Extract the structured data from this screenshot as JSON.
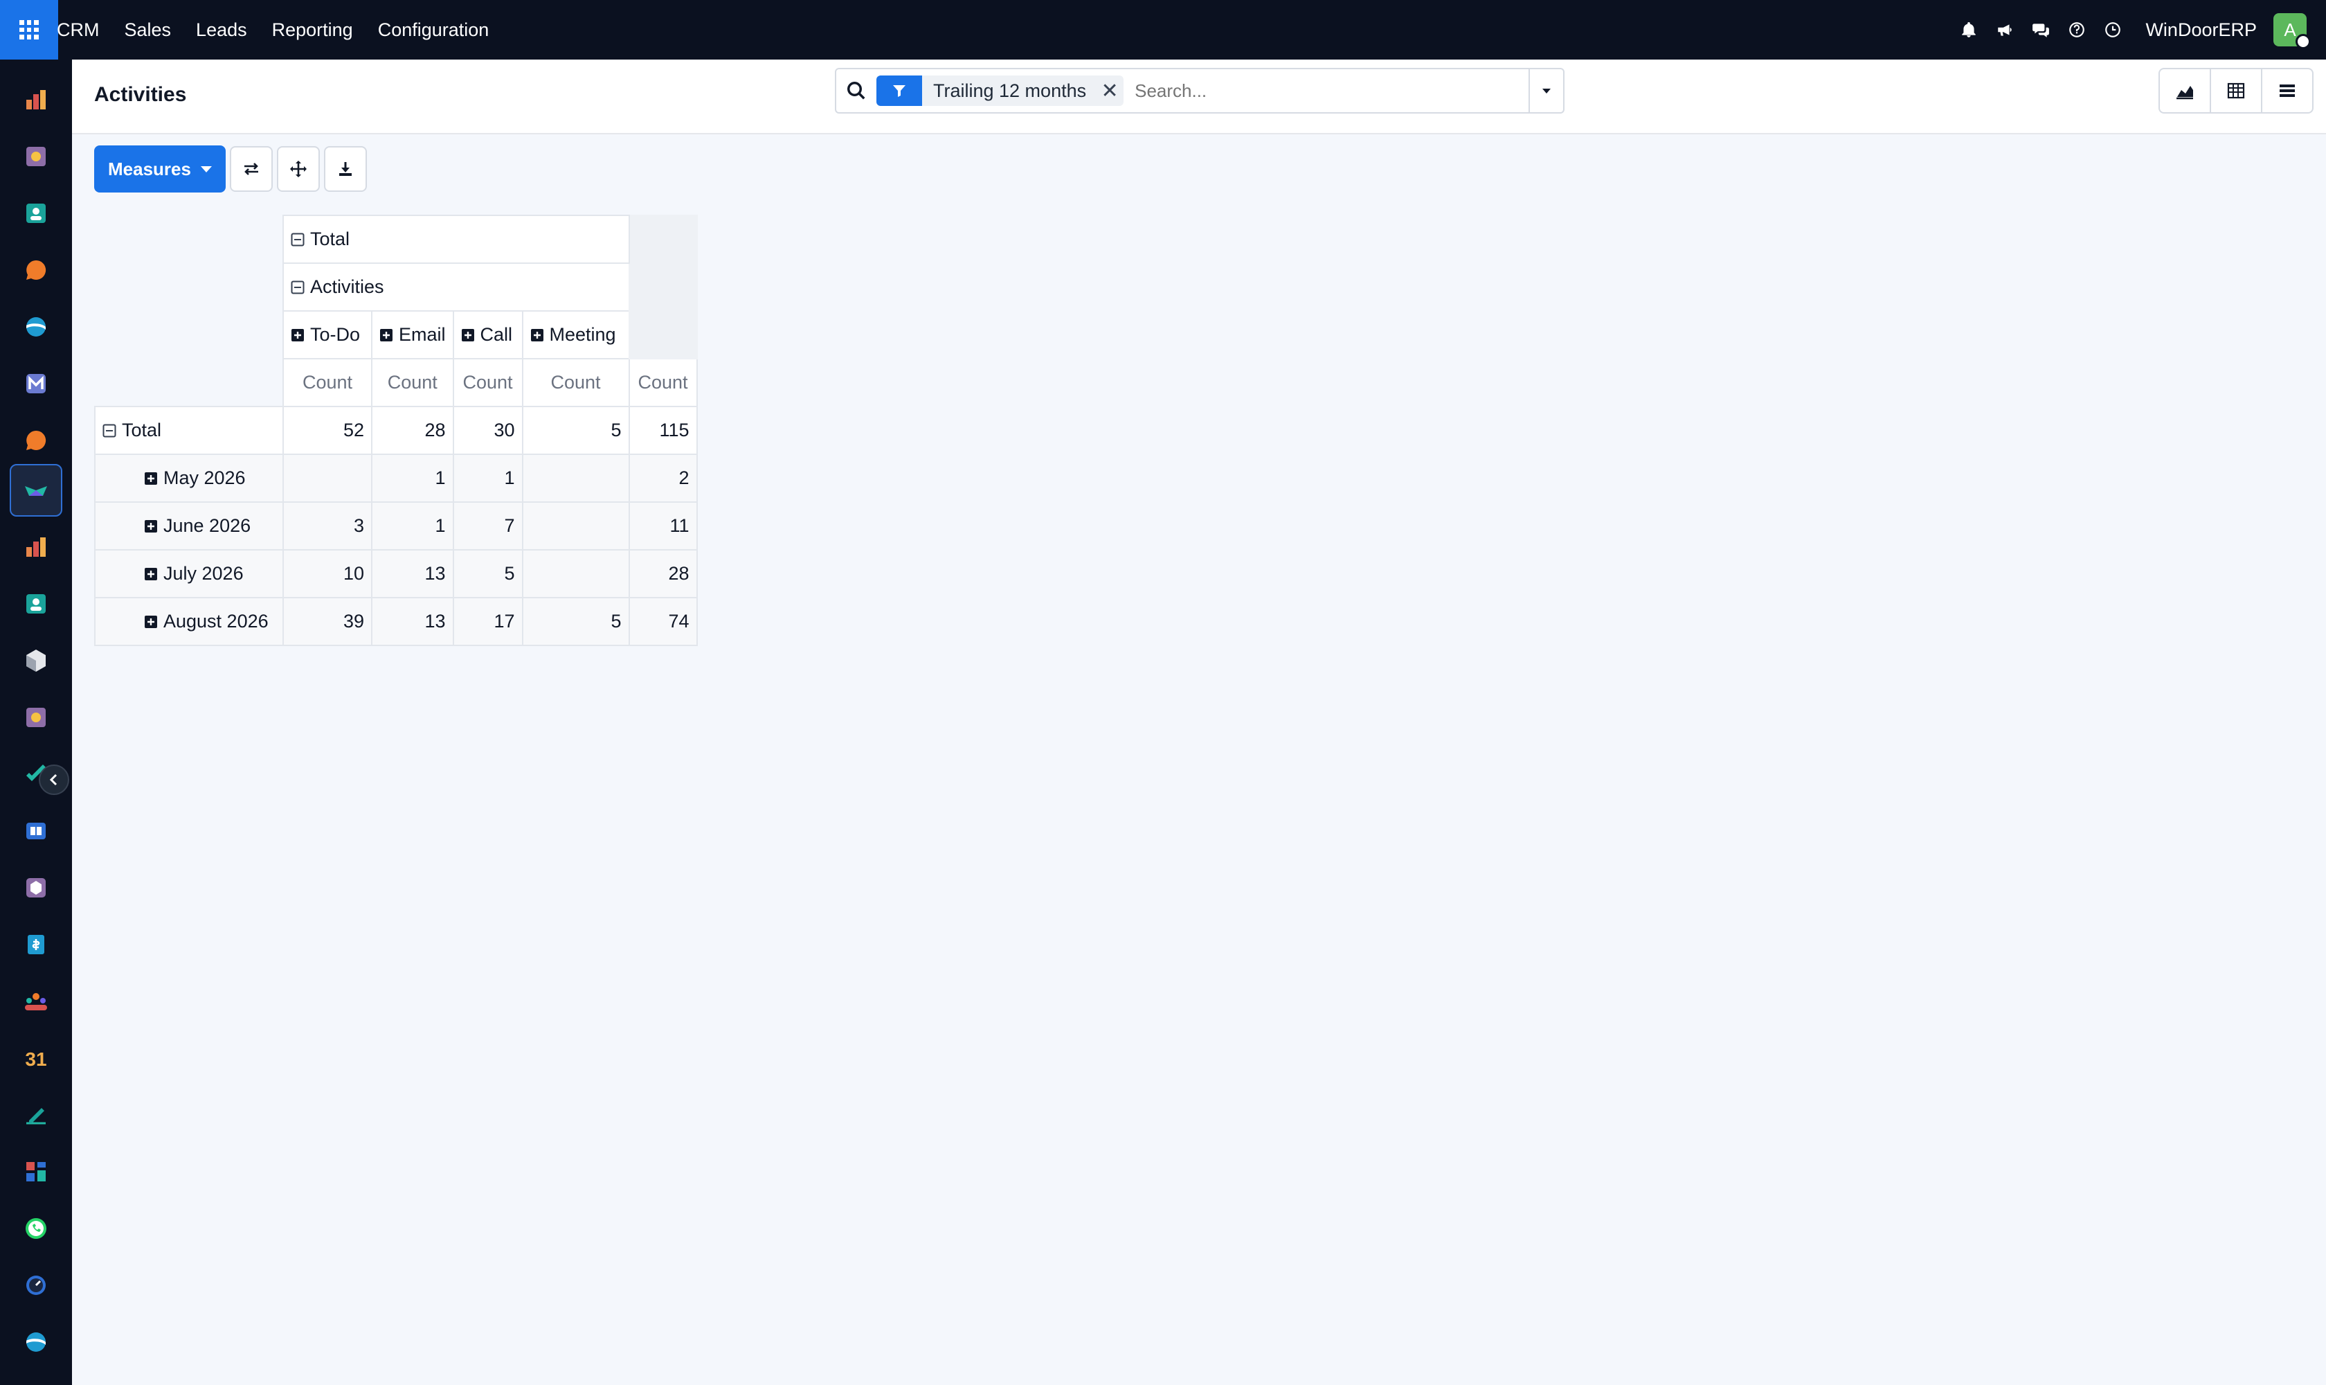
{
  "topbar": {
    "menu": [
      "CRM",
      "Sales",
      "Leads",
      "Reporting",
      "Configuration"
    ],
    "company": "WinDoorERP",
    "avatar_initial": "A",
    "icons": [
      "bell-icon",
      "megaphone-icon",
      "chat-icon",
      "help-icon",
      "clock-icon"
    ]
  },
  "rail": {
    "apps": [
      "reporting-app-icon",
      "documents-app-icon",
      "contacts-app-icon",
      "discuss-app-icon",
      "website-app-icon",
      "email-marketing-app-icon",
      "live-chat-app-icon",
      "crm-app-icon",
      "sales-app-icon",
      "employees-app-icon",
      "inventory-app-icon",
      "knowledge-app-icon",
      "project-app-icon",
      "elearning-app-icon",
      "manufacturing-app-icon",
      "invoicing-app-icon",
      "team-app-icon",
      "calendar-app-icon",
      "sign-app-icon",
      "dashboards-app-icon",
      "whatsapp-app-icon",
      "timer-app-icon",
      "odoo-app-icon"
    ],
    "calendar_day": "31"
  },
  "control": {
    "title": "Activities",
    "facet_label": "Trailing 12 months",
    "search_placeholder": "Search...",
    "views": [
      "graph-view-icon",
      "pivot-view-icon",
      "list-view-icon"
    ]
  },
  "toolbar": {
    "measures_label": "Measures"
  },
  "pivot": {
    "col_total_label": "Total",
    "col_group_label": "Activities",
    "col_types": [
      "To-Do",
      "Email",
      "Call",
      "Meeting"
    ],
    "measure_label": "Count",
    "row_total_label": "Total",
    "totals": [
      "52",
      "28",
      "30",
      "5",
      "115"
    ],
    "rows": [
      {
        "label": "May 2026",
        "values": [
          "",
          "1",
          "1",
          "",
          "2"
        ]
      },
      {
        "label": "June 2026",
        "values": [
          "3",
          "1",
          "7",
          "",
          "11"
        ]
      },
      {
        "label": "July 2026",
        "values": [
          "10",
          "13",
          "5",
          "",
          "28"
        ]
      },
      {
        "label": "August 2026",
        "values": [
          "39",
          "13",
          "17",
          "5",
          "74"
        ]
      }
    ]
  },
  "colors": {
    "topbar_bg": "#0b1120",
    "primary": "#1a73e8",
    "page_bg": "#f4f7fc"
  }
}
